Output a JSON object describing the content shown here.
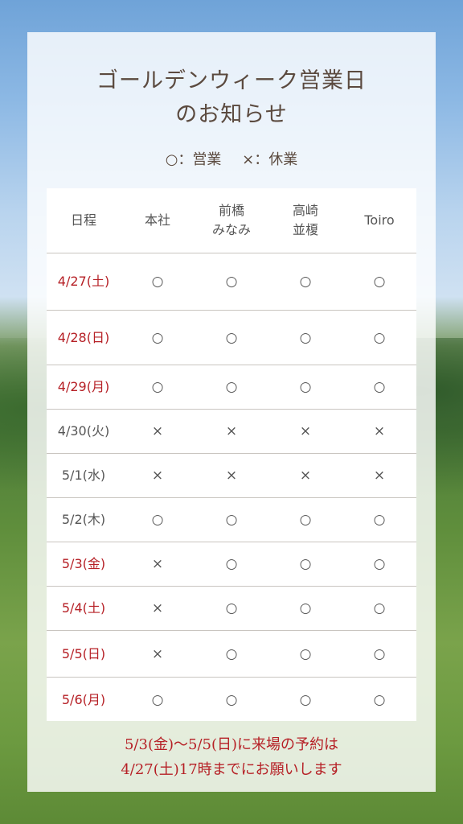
{
  "title_line1": "ゴールデンウィーク営業日",
  "title_line2": "のお知らせ",
  "legend": {
    "open": "○：営業",
    "closed": "×：休業"
  },
  "header": {
    "date": "日程",
    "col1": "本社",
    "col2_l1": "前橋",
    "col2_l2": "みなみ",
    "col3_l1": "高崎",
    "col3_l2": "並榎",
    "col4": "Toiro"
  },
  "rows": [
    {
      "date": "4/27(土)",
      "holiday": true,
      "m": [
        "○",
        "○",
        "○",
        "○"
      ]
    },
    {
      "date": "4/28(日)",
      "holiday": true,
      "m": [
        "○",
        "○",
        "○",
        "○"
      ]
    },
    {
      "date": "4/29(月)",
      "holiday": true,
      "m": [
        "○",
        "○",
        "○",
        "○"
      ]
    },
    {
      "date": "4/30(火)",
      "holiday": false,
      "m": [
        "×",
        "×",
        "×",
        "×"
      ]
    },
    {
      "date": "5/1(水)",
      "holiday": false,
      "m": [
        "×",
        "×",
        "×",
        "×"
      ]
    },
    {
      "date": "5/2(木)",
      "holiday": false,
      "m": [
        "○",
        "○",
        "○",
        "○"
      ]
    },
    {
      "date": "5/3(金)",
      "holiday": true,
      "m": [
        "×",
        "○",
        "○",
        "○"
      ]
    },
    {
      "date": "5/4(土)",
      "holiday": true,
      "m": [
        "×",
        "○",
        "○",
        "○"
      ]
    },
    {
      "date": "5/5(日)",
      "holiday": true,
      "m": [
        "×",
        "○",
        "○",
        "○"
      ]
    },
    {
      "date": "5/6(月)",
      "holiday": true,
      "m": [
        "○",
        "○",
        "○",
        "○"
      ]
    }
  ],
  "note_line1": "5/3(金)〜5/5(日)に来場の予約は",
  "note_line2": "4/27(土)17時までにお願いします",
  "colors": {
    "accent_red": "#b62026",
    "text_brown": "#5b4a3f"
  }
}
